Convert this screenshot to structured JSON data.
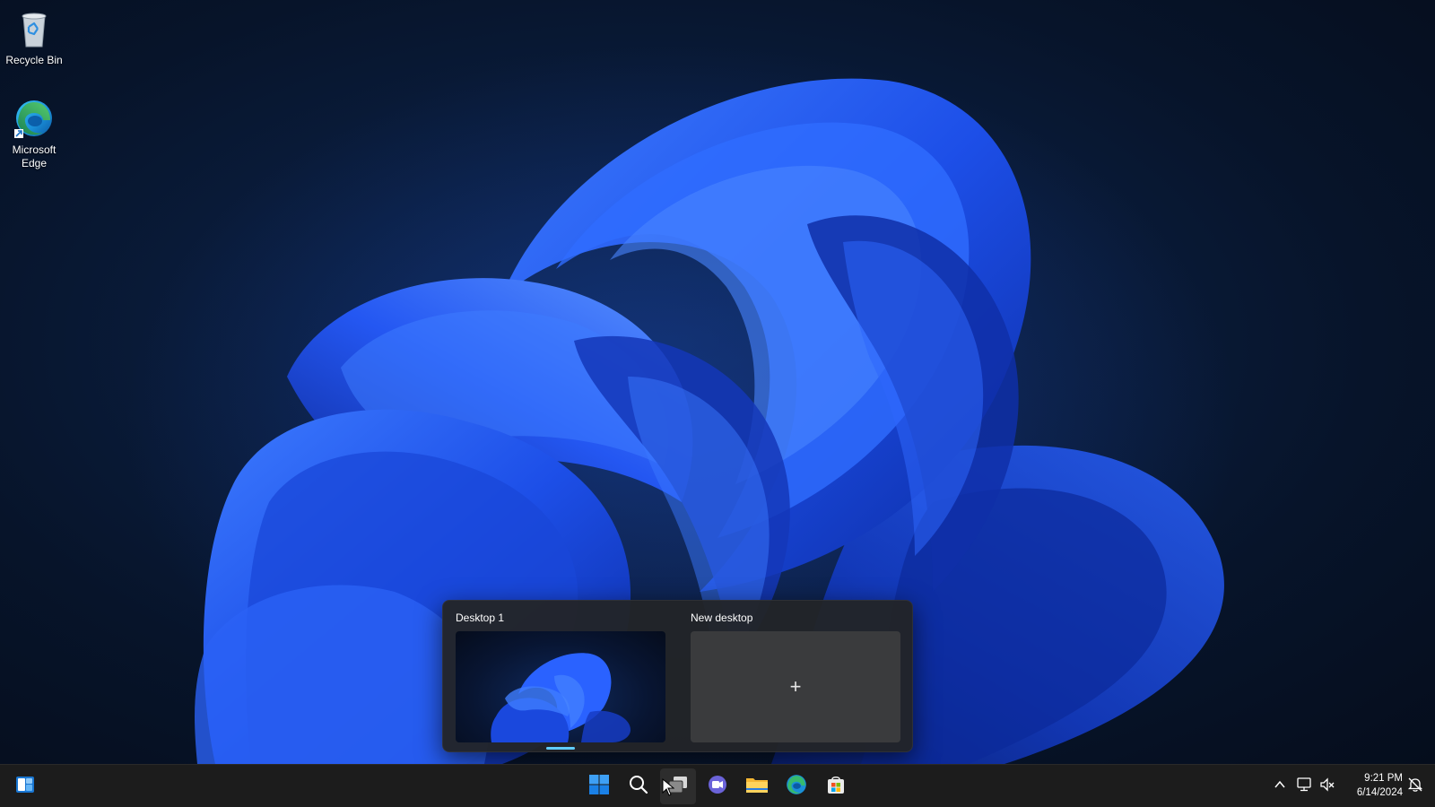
{
  "desktop": {
    "icons": [
      {
        "label": "Recycle Bin",
        "icon": "recycle-bin-icon"
      },
      {
        "label": "Microsoft\nEdge",
        "icon": "edge-icon"
      }
    ]
  },
  "taskview": {
    "desktops": [
      {
        "title": "Desktop 1",
        "active": true
      },
      {
        "title": "New desktop",
        "add_glyph": "+"
      }
    ]
  },
  "taskbar": {
    "pinned": [
      {
        "name": "Widgets",
        "icon": "widgets-icon"
      },
      {
        "name": "Start",
        "icon": "windows-start-icon"
      },
      {
        "name": "Search",
        "icon": "search-icon"
      },
      {
        "name": "Task View",
        "icon": "task-view-icon"
      },
      {
        "name": "Chat",
        "icon": "teams-chat-icon"
      },
      {
        "name": "File Explorer",
        "icon": "folder-icon"
      },
      {
        "name": "Microsoft Edge",
        "icon": "edge-icon"
      },
      {
        "name": "Microsoft Store",
        "icon": "store-icon"
      }
    ],
    "tray": {
      "time": "9:21 PM",
      "date": "6/14/2024",
      "icons": [
        "chevron-up-icon",
        "network-icon",
        "volume-icon",
        "notification-icon"
      ]
    }
  },
  "colors": {
    "accent": "#60cdff",
    "taskbar": "#1c1c1c",
    "flyout": "#222428",
    "wallpaper_blue": "#1f4fe0"
  }
}
